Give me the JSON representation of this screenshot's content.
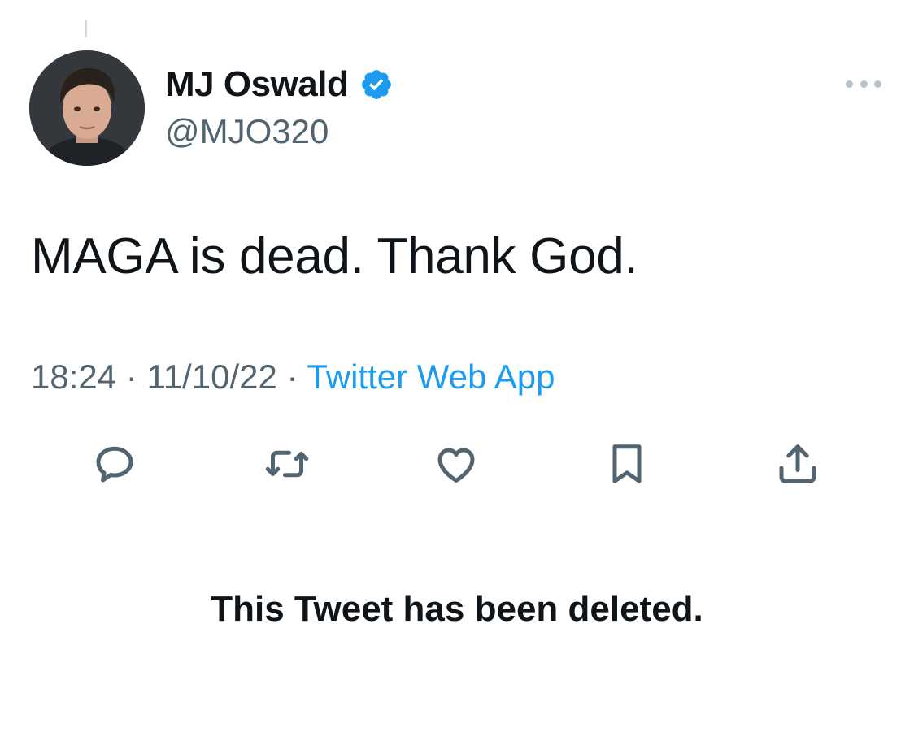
{
  "tweet": {
    "author": {
      "display_name": "MJ Oswald",
      "handle": "@MJO320",
      "verified": true
    },
    "text": "MAGA is dead. Thank God.",
    "time": "18:24",
    "separator": "·",
    "date": "11/10/22",
    "source": "Twitter Web App",
    "notice": "This Tweet has been deleted."
  },
  "icons": {
    "reply": "reply-icon",
    "retweet": "retweet-icon",
    "like": "like-icon",
    "bookmark": "bookmark-icon",
    "share": "share-icon",
    "more": "more-icon",
    "verified": "verified-badge-icon"
  },
  "colors": {
    "text_primary": "#0f1419",
    "text_secondary": "#536471",
    "accent": "#1d9bf0"
  }
}
